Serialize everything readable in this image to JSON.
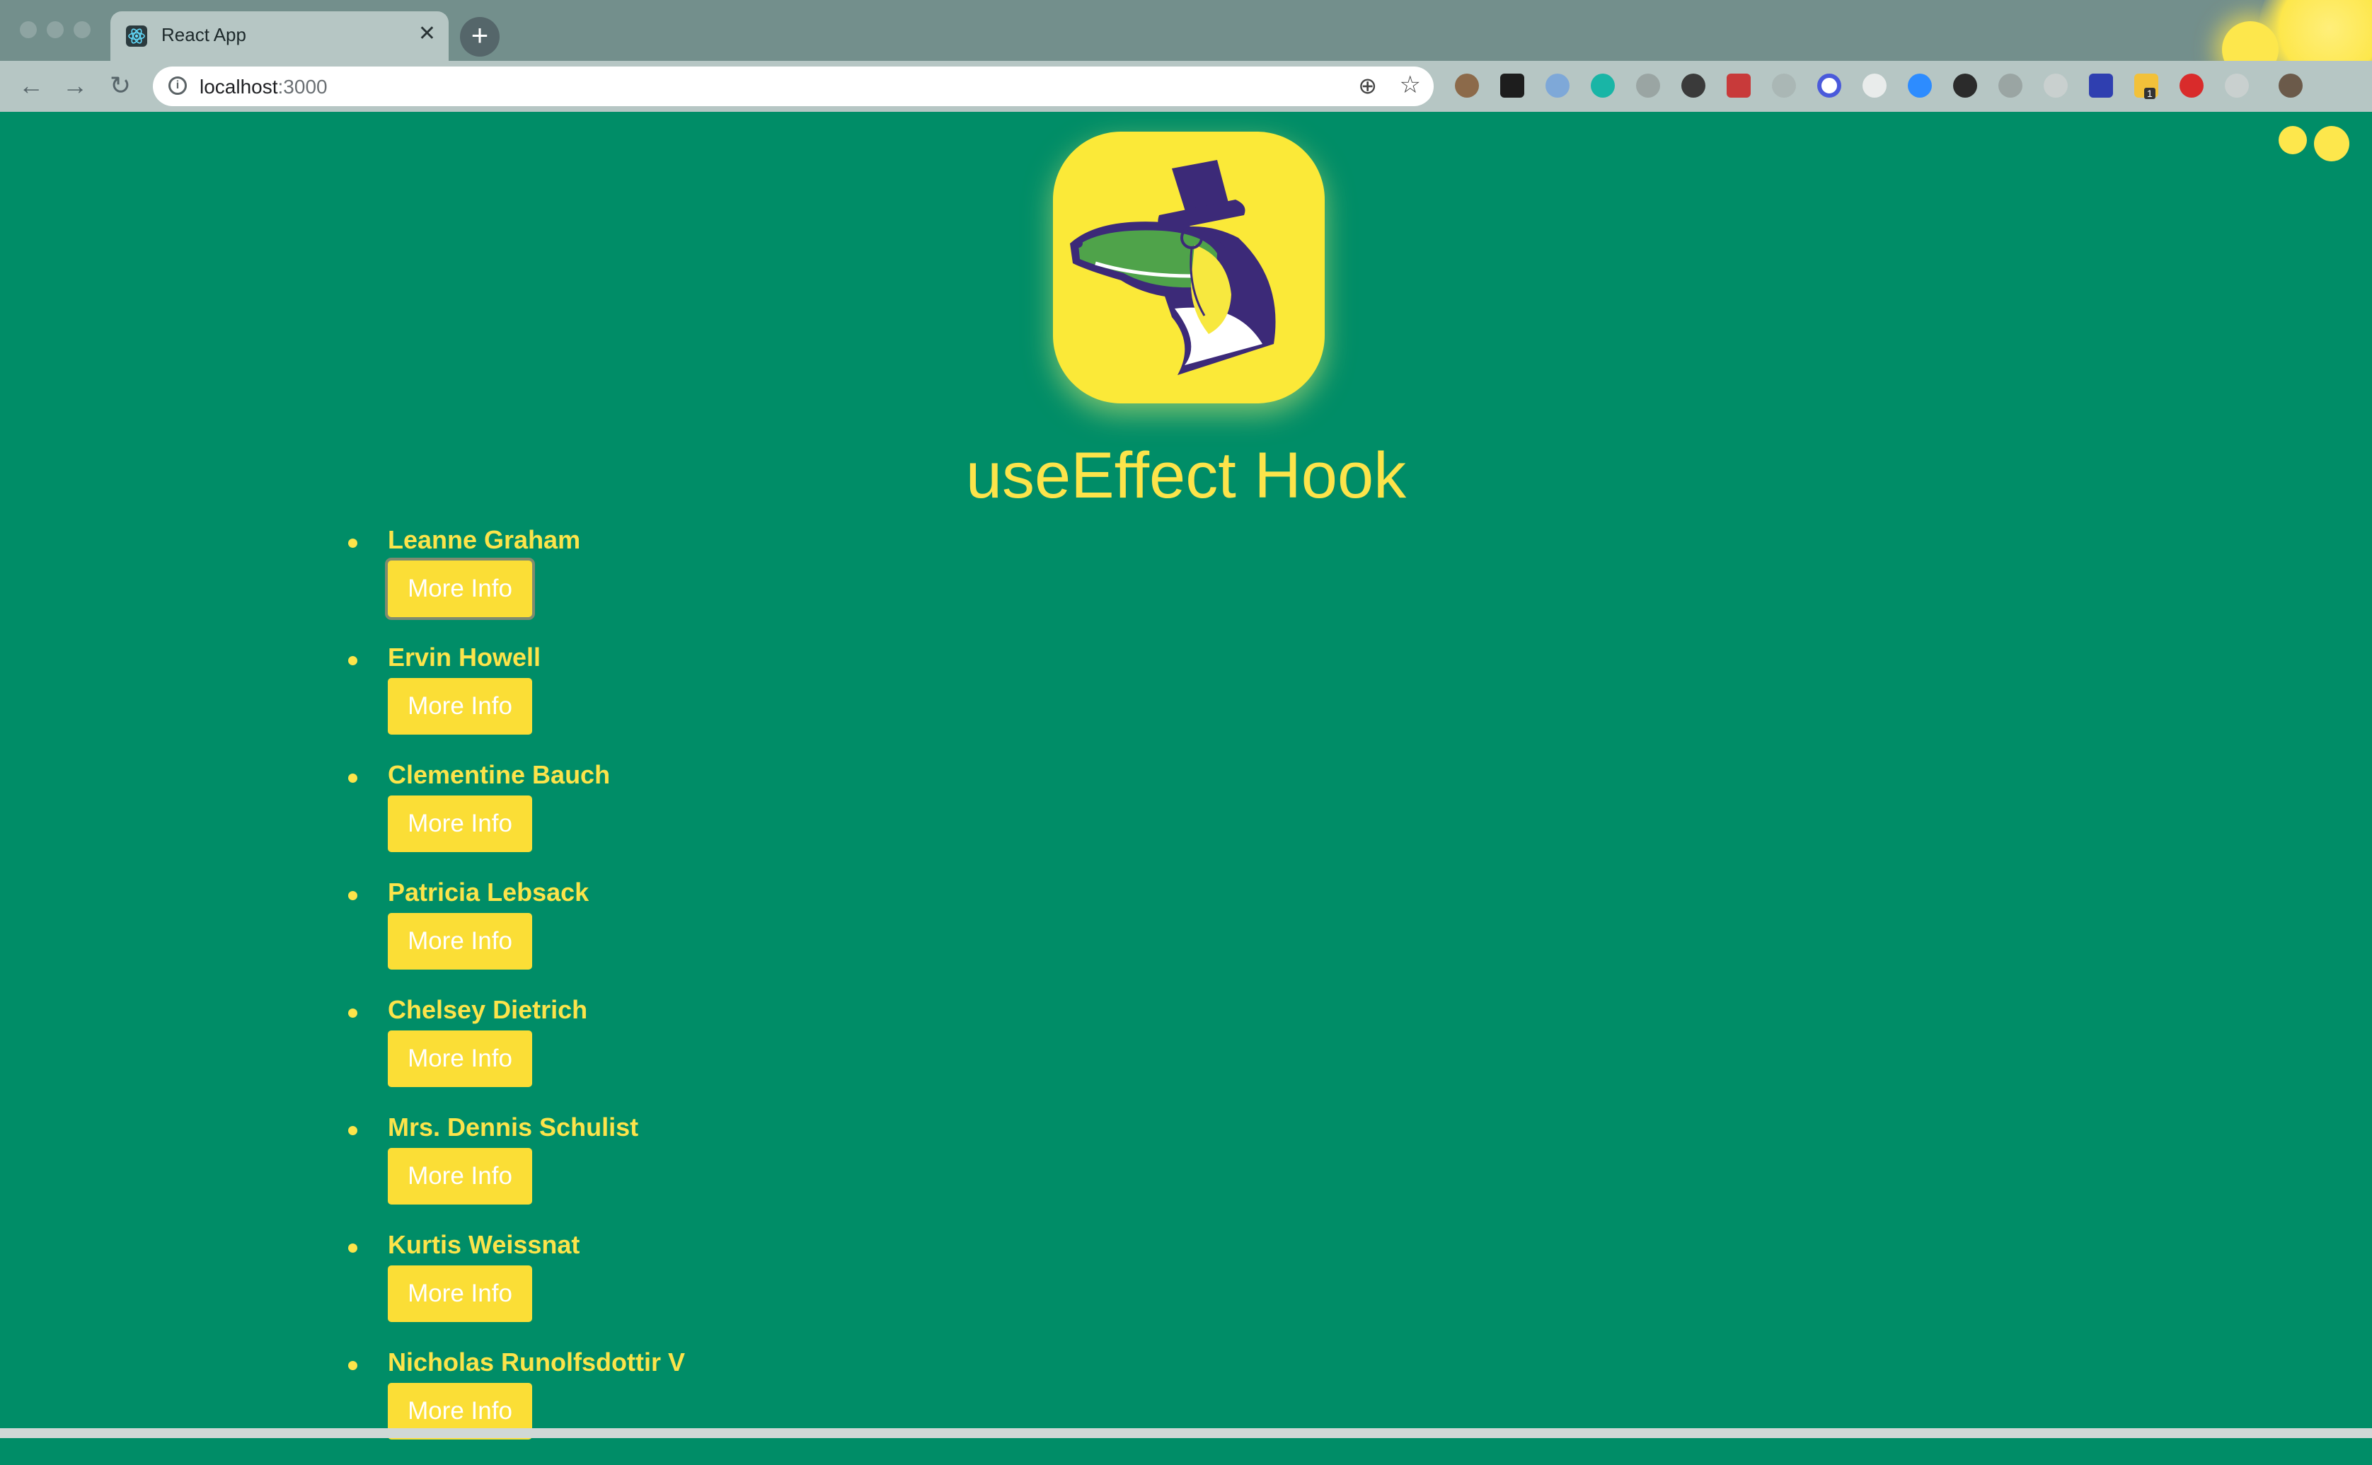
{
  "browser": {
    "tab_title": "React App",
    "url_host": "localhost",
    "url_port": ":3000",
    "tab_close_glyph": "✕",
    "new_tab_glyph": "+",
    "extensions_badge": "1"
  },
  "page": {
    "heading": "useEffect Hook",
    "background_color": "#008d67",
    "accent_color": "#fce44a",
    "button_color": "#fbde36",
    "logo_icon": "alligator-top-hat-monocle-icon"
  },
  "users": [
    {
      "name": "Leanne Graham",
      "button_label": "More Info",
      "focused": true
    },
    {
      "name": "Ervin Howell",
      "button_label": "More Info"
    },
    {
      "name": "Clementine Bauch",
      "button_label": "More Info"
    },
    {
      "name": "Patricia Lebsack",
      "button_label": "More Info"
    },
    {
      "name": "Chelsey Dietrich",
      "button_label": "More Info"
    },
    {
      "name": "Mrs. Dennis Schulist",
      "button_label": "More Info"
    },
    {
      "name": "Kurtis Weissnat",
      "button_label": "More Info"
    },
    {
      "name": "Nicholas Runolfsdottir V",
      "button_label": "More Info"
    }
  ]
}
